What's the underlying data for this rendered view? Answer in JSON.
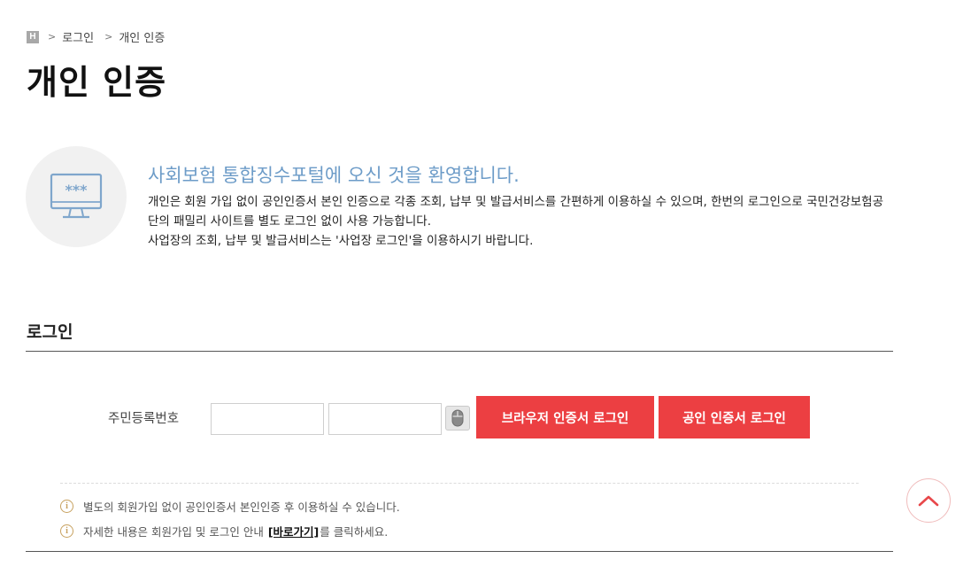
{
  "breadcrumb": {
    "home_letter": "H",
    "separator": ">",
    "items": [
      "로그인",
      "개인 인증"
    ]
  },
  "page_title": "개인 인증",
  "welcome": {
    "title": "사회보험 통합징수포털에 오신 것을 환영합니다.",
    "line1": "개인은 회원 가입 없이 공인인증서 본인 인증으로 각종 조회, 납부 및 발급서비스를 간편하게 이용하실 수 있으며, 한번의 로그인으로 국민건강보험공단의 패밀리 사이트를 별도 로그인 없이 사용 가능합니다.",
    "line2": "사업장의 조회, 납부 및 발급서비스는 '사업장 로그인'을 이용하시기 바랍니다.",
    "monitor_icon": "monitor-password-icon",
    "monitor_text": "***"
  },
  "login": {
    "section_title": "로그인",
    "rrn_label": "주민등록번호",
    "rrn_front_value": "",
    "rrn_back_value": "",
    "browser_cert_button": "브라우저 인증서 로그인",
    "public_cert_button": "공인 인증서 로그인"
  },
  "notices": {
    "item1": "별도의 회원가입 없이 공인인증서 본인인증 후 이용하실 수 있습니다.",
    "item2_before": "자세한 내용은 회원가입 및 로그인 안내 ",
    "item2_link": "[바로가기]",
    "item2_after": "를 클릭하세요.",
    "icon_letter": "i"
  },
  "colors": {
    "accent_red": "#ec3f42",
    "welcome_blue": "#6d9cc8",
    "info_gold": "#c7a15f"
  },
  "icons": {
    "top": "chevron-up-icon",
    "mouse": "mouse-icon",
    "info": "info-icon",
    "home": "home-icon"
  }
}
